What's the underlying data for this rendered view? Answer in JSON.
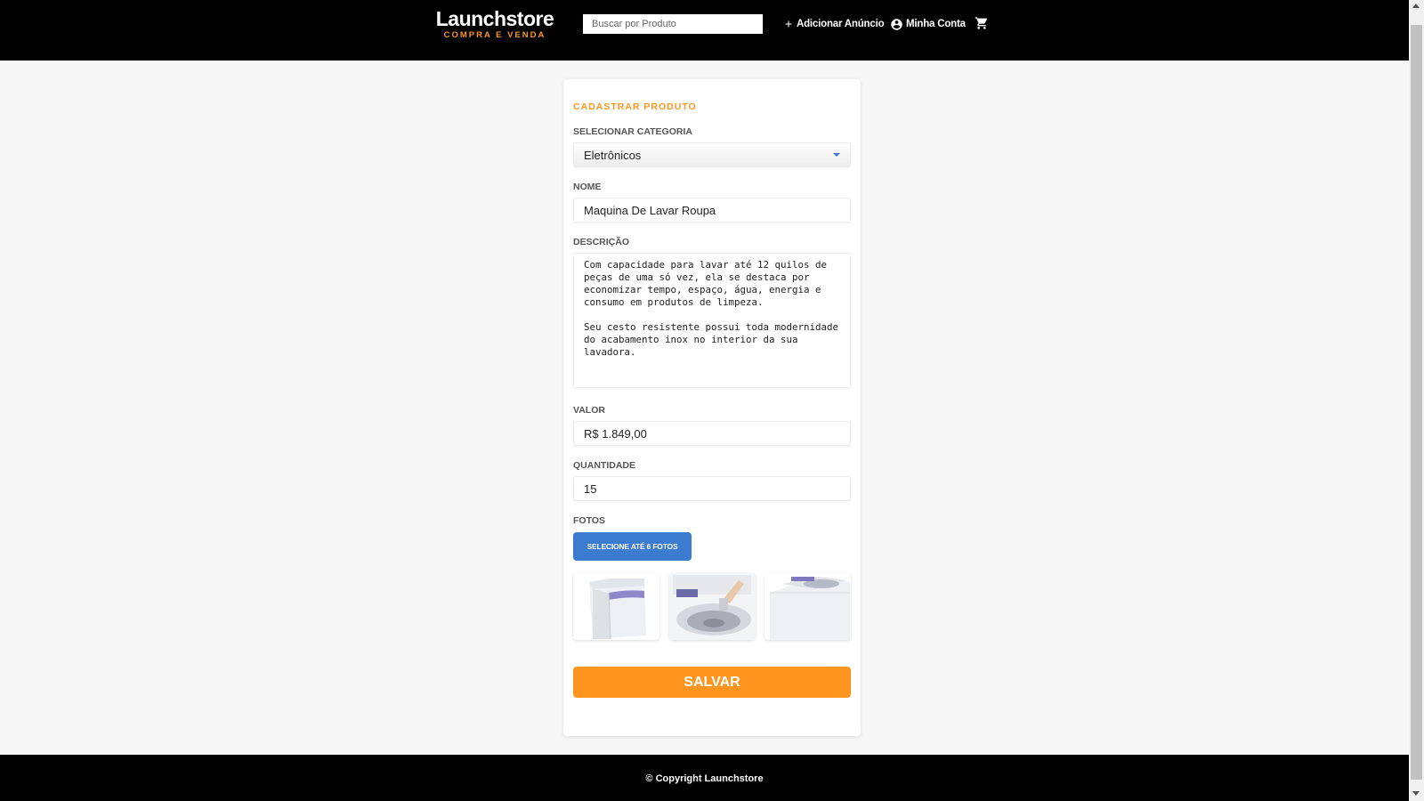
{
  "header": {
    "logo_main": "Launchstore",
    "logo_sub": "COMPRA E VENDA",
    "search_placeholder": "Buscar por Produto",
    "add_ad_label": "Adicionar Anúncio",
    "account_label": "Minha Conta",
    "icons": {
      "add": "plus-icon",
      "account": "account-circle-icon",
      "cart": "shopping-cart-icon"
    }
  },
  "form": {
    "title": "CADASTRAR PRODUTO",
    "category_label": "SELECIONAR CATEGORIA",
    "category_value": "Eletrônicos",
    "name_label": "NOME",
    "name_value": "Maquina De Lavar Roupa",
    "description_label": "DESCRIÇÃO",
    "description_value": "Com capacidade para lavar até 12 quilos de peças de uma só vez, ela se destaca por economizar tempo, espaço, água, energia e consumo em produtos de limpeza.\n\nSeu cesto resistente possui toda modernidade do acabamento inox no interior da sua lavadora.",
    "price_label": "VALOR",
    "price_value": "R$ 1.849,00",
    "quantity_label": "QUANTIDADE",
    "quantity_value": "15",
    "photos_label": "FOTOS",
    "photos_button": "SELECIONE ATÉ 6 FOTOS",
    "photo_count": 3,
    "save_button": "SALVAR"
  },
  "footer": {
    "copyright": "© Copyright Launchstore"
  },
  "colors": {
    "accent": "#fd951f",
    "primary": "#3b7bd0",
    "header_bg": "#000000",
    "page_bg": "#f7f7f7"
  }
}
